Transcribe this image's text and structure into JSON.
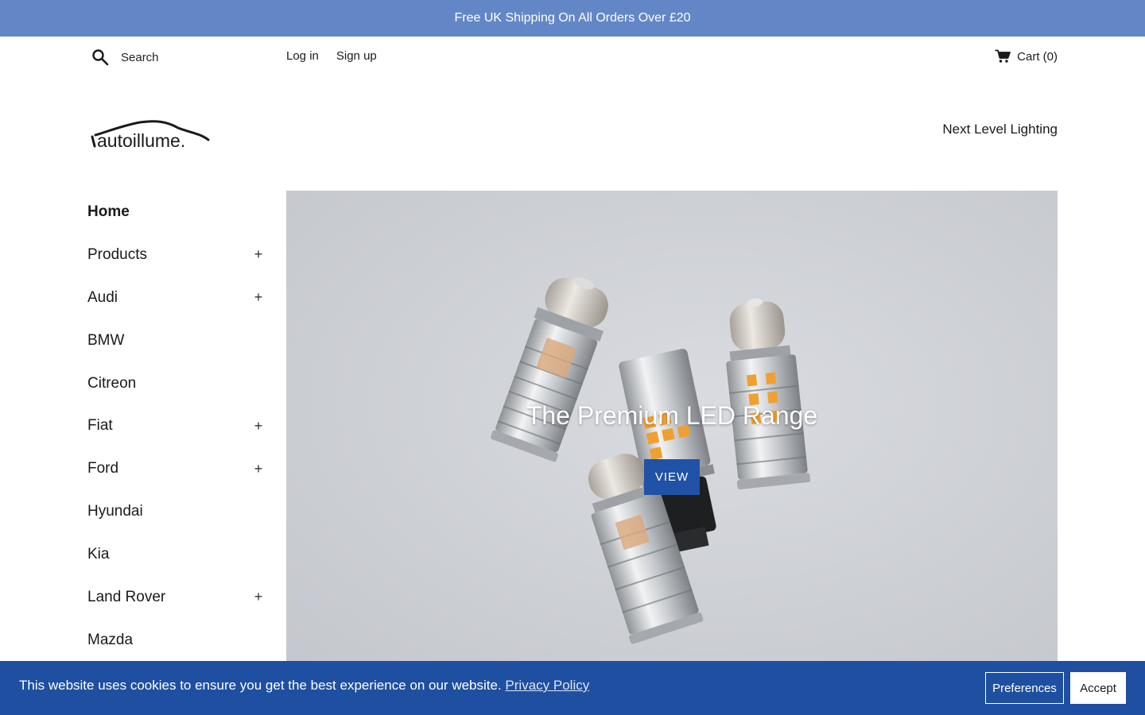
{
  "announcement": {
    "text": "Free UK Shipping On All Orders Over £20"
  },
  "header": {
    "search_placeholder": "Search",
    "login": "Log in",
    "signup": "Sign up",
    "cart": "Cart (0)"
  },
  "brand": {
    "logo_text": "autoillume.",
    "tagline": "Next Level Lighting"
  },
  "sidebar": {
    "items": [
      {
        "label": "Home",
        "active": true,
        "expandable": false,
        "expand": ""
      },
      {
        "label": "Products",
        "active": false,
        "expandable": true,
        "expand": "+"
      },
      {
        "label": "Audi",
        "active": false,
        "expandable": true,
        "expand": "+"
      },
      {
        "label": "BMW",
        "active": false,
        "expandable": false,
        "expand": ""
      },
      {
        "label": "Citreon",
        "active": false,
        "expandable": false,
        "expand": ""
      },
      {
        "label": "Fiat",
        "active": false,
        "expandable": true,
        "expand": "+"
      },
      {
        "label": "Ford",
        "active": false,
        "expandable": true,
        "expand": "+"
      },
      {
        "label": "Hyundai",
        "active": false,
        "expandable": false,
        "expand": ""
      },
      {
        "label": "Kia",
        "active": false,
        "expandable": false,
        "expand": ""
      },
      {
        "label": "Land Rover",
        "active": false,
        "expandable": true,
        "expand": "+"
      },
      {
        "label": "Mazda",
        "active": false,
        "expandable": false,
        "expand": ""
      }
    ]
  },
  "hero": {
    "title": "The Premium LED Range",
    "button": "VIEW"
  },
  "cookie": {
    "text": "This website uses cookies to ensure you get the best experience on our website.",
    "link": "Privacy Policy",
    "preferences": "Preferences",
    "accept": "Accept"
  },
  "colors": {
    "announcement_bg": "#6387c6",
    "accent_blue": "#2052a7",
    "cookie_bg": "#1e4fa0",
    "led_amber": "#f0a030"
  }
}
